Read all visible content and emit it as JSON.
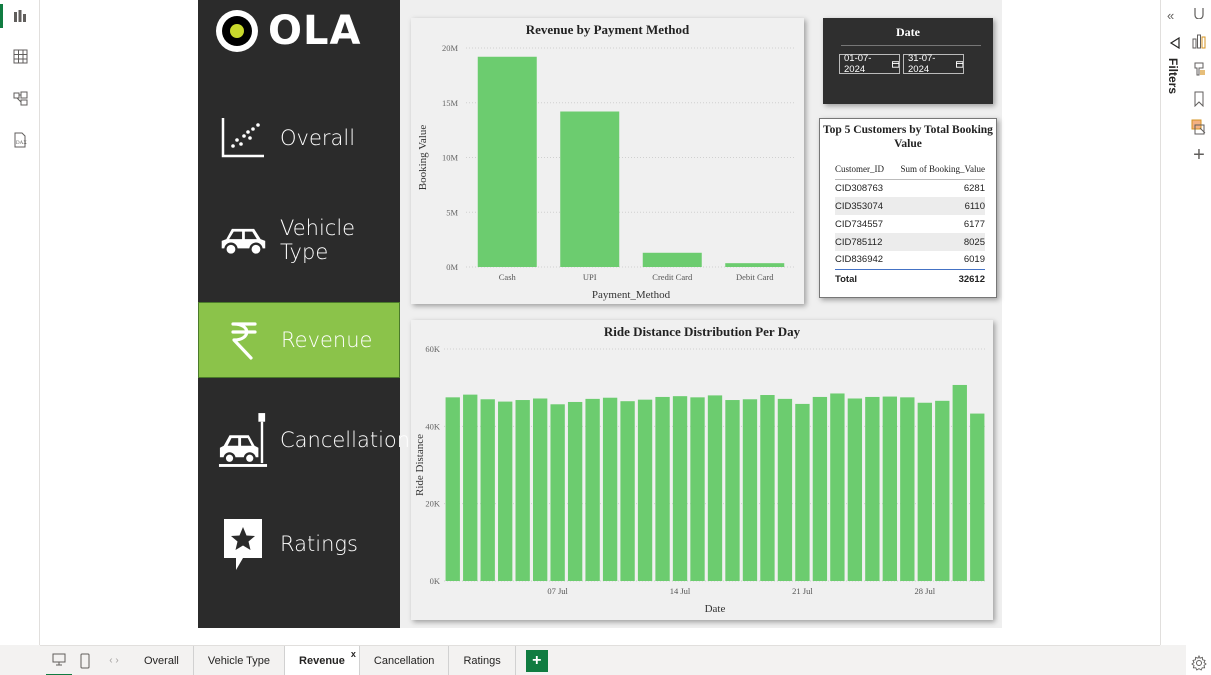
{
  "left_rail": {
    "icons": [
      "report-view-icon",
      "table-view-icon",
      "model-view-icon",
      "dax-query-icon"
    ]
  },
  "logo": {
    "text": "OLA"
  },
  "nav": {
    "items": [
      {
        "label": "Overall",
        "icon": "scatter-chart-icon"
      },
      {
        "label": "Vehicle Type",
        "icon": "car-icon"
      },
      {
        "label": "Revenue",
        "icon": "rupee-icon",
        "active": true
      },
      {
        "label": "Cancellation",
        "icon": "car-crash-icon"
      },
      {
        "label": "Ratings",
        "icon": "star-chat-icon"
      }
    ]
  },
  "date_slicer": {
    "title": "Date",
    "start": "01-07-2024",
    "end": "31-07-2024"
  },
  "top_customers": {
    "title_line1": "Top 5 Customers by Total Booking",
    "title_line2": "Value",
    "columns": [
      "Customer_ID",
      "Sum of Booking_Value"
    ],
    "rows": [
      [
        "CID308763",
        "6281"
      ],
      [
        "CID353074",
        "6110"
      ],
      [
        "CID734557",
        "6177"
      ],
      [
        "CID785112",
        "8025"
      ],
      [
        "CID836942",
        "6019"
      ]
    ],
    "total_label": "Total",
    "total_value": "32612"
  },
  "tabs": {
    "items": [
      "Overall",
      "Vehicle Type",
      "Revenue",
      "Cancellation",
      "Ratings"
    ],
    "active": "Revenue",
    "close_label": "x",
    "add_label": "+"
  },
  "filters_label": "Filters",
  "colors": {
    "bar": "#6ccc6f",
    "nav_bg": "#2b2b2b",
    "active_nav": "#8bc34a",
    "accent": "#107c41"
  },
  "chart_data": [
    {
      "type": "bar",
      "title": "Revenue by Payment Method",
      "xlabel": "Payment_Method",
      "ylabel": "Booking Value",
      "categories": [
        "Cash",
        "UPI",
        "Credit Card",
        "Debit Card"
      ],
      "values": [
        19200000,
        14200000,
        1300000,
        350000
      ],
      "yticks": [
        "0M",
        "5M",
        "10M",
        "15M",
        "20M"
      ],
      "ylim": [
        0,
        20000000
      ],
      "grid": true
    },
    {
      "type": "bar",
      "title": "Ride Distance Distribution Per Day",
      "xlabel": "Date",
      "ylabel": "Ride Distance",
      "x": [
        "2024-07-01",
        "2024-07-02",
        "2024-07-03",
        "2024-07-04",
        "2024-07-05",
        "2024-07-06",
        "2024-07-07",
        "2024-07-08",
        "2024-07-09",
        "2024-07-10",
        "2024-07-11",
        "2024-07-12",
        "2024-07-13",
        "2024-07-14",
        "2024-07-15",
        "2024-07-16",
        "2024-07-17",
        "2024-07-18",
        "2024-07-19",
        "2024-07-20",
        "2024-07-21",
        "2024-07-22",
        "2024-07-23",
        "2024-07-24",
        "2024-07-25",
        "2024-07-26",
        "2024-07-27",
        "2024-07-28",
        "2024-07-29",
        "2024-07-30",
        "2024-07-31"
      ],
      "values": [
        47500,
        48200,
        47000,
        46400,
        46800,
        47200,
        45700,
        46300,
        47100,
        47400,
        46500,
        46900,
        47600,
        47800,
        47500,
        48000,
        46800,
        47000,
        48100,
        47100,
        45800,
        47600,
        48500,
        47200,
        47600,
        47700,
        47500,
        46100,
        46600,
        50700,
        43300
      ],
      "xticks": [
        "07 Jul",
        "14 Jul",
        "21 Jul",
        "28 Jul"
      ],
      "yticks": [
        "0K",
        "20K",
        "40K",
        "60K"
      ],
      "ylim": [
        0,
        60000
      ],
      "grid": true
    }
  ]
}
